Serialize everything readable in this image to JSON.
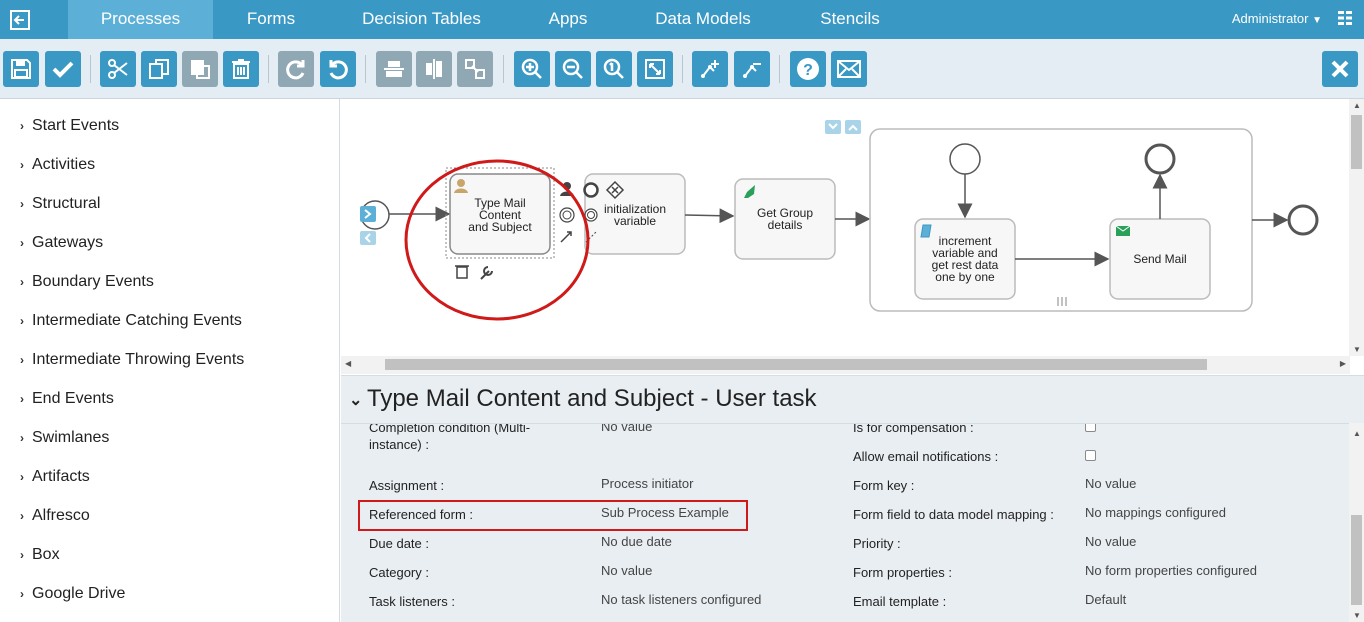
{
  "nav": {
    "tabs": [
      "Processes",
      "Forms",
      "Decision Tables",
      "Apps",
      "Data Models",
      "Stencils"
    ],
    "user": "Administrator"
  },
  "toolbar": {
    "buttons": [
      "save-icon",
      "validate-icon",
      "cut-icon",
      "copy-icon",
      "paste-icon",
      "delete-icon",
      "redo-icon",
      "undo-icon",
      "align-horizontal-icon",
      "align-vertical-icon",
      "same-size-icon",
      "zoom-in-icon",
      "zoom-out-icon",
      "zoom-actual-icon",
      "zoom-fit-icon",
      "bend-point-add-icon",
      "bend-point-remove-icon",
      "help-icon",
      "feedback-icon",
      "close-icon"
    ]
  },
  "sidebar": {
    "items": [
      {
        "label": "Start Events"
      },
      {
        "label": "Activities"
      },
      {
        "label": "Structural"
      },
      {
        "label": "Gateways"
      },
      {
        "label": "Boundary Events"
      },
      {
        "label": "Intermediate Catching Events"
      },
      {
        "label": "Intermediate Throwing Events"
      },
      {
        "label": "End Events"
      },
      {
        "label": "Swimlanes"
      },
      {
        "label": "Artifacts"
      },
      {
        "label": "Alfresco"
      },
      {
        "label": "Box"
      },
      {
        "label": "Google Drive"
      }
    ]
  },
  "diagram": {
    "task1": [
      "Type Mail",
      "Content",
      "and Subject"
    ],
    "task2": [
      "initialization",
      "variable"
    ],
    "task3": [
      "Get Group",
      "details"
    ],
    "task4": [
      "increment",
      "variable and",
      "get rest data",
      "one by one"
    ],
    "task5": [
      "Send Mail"
    ]
  },
  "properties": {
    "title": "Type Mail Content and Subject - User task",
    "left": [
      {
        "label": "Completion condition (Multi-",
        "label2": "instance) :",
        "value": "No value"
      },
      {
        "label": "Assignment :",
        "value": "Process initiator"
      },
      {
        "label": "Referenced form :",
        "value": "Sub Process Example"
      },
      {
        "label": "Due date :",
        "value": "No due date"
      },
      {
        "label": "Category :",
        "value": "No value"
      },
      {
        "label": "Task listeners :",
        "value": "No task listeners configured"
      }
    ],
    "right": [
      {
        "label": "Is for compensation :",
        "value": ""
      },
      {
        "label": "Allow email notifications :",
        "value": ""
      },
      {
        "label": "Form key :",
        "value": "No value"
      },
      {
        "label": "Form field to data model mapping :",
        "value": "No mappings configured"
      },
      {
        "label": "Priority :",
        "value": "No value"
      },
      {
        "label": "Form properties :",
        "value": "No form properties configured"
      },
      {
        "label": "Email template :",
        "value": "Default"
      }
    ]
  },
  "colors": {
    "nav": "#3a98c4",
    "nav_active": "#5cb0d7",
    "toolbar_button": "#3a98c4",
    "highlight": "#d01919"
  }
}
